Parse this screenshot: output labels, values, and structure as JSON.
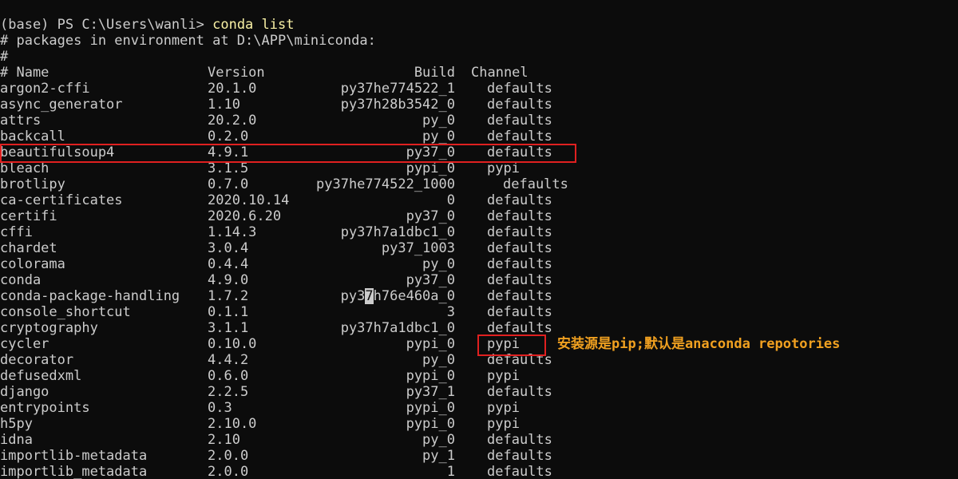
{
  "terminal": {
    "prompt": "(base) PS C:\\Users\\wanli> ",
    "command": "conda list",
    "header_line": "# packages in environment at D:\\APP\\miniconda:",
    "hash_line": "#",
    "columns": {
      "name": "# Name",
      "version": "Version",
      "build": "Build",
      "channel": "Channel"
    },
    "rows": [
      {
        "name": "argon2-cffi",
        "version": "20.1.0",
        "build": "py37he774522_1",
        "channel": "defaults"
      },
      {
        "name": "async_generator",
        "version": "1.10",
        "build": "py37h28b3542_0",
        "channel": "defaults"
      },
      {
        "name": "attrs",
        "version": "20.2.0",
        "build": "py_0",
        "channel": "defaults"
      },
      {
        "name": "backcall",
        "version": "0.2.0",
        "build": "py_0",
        "channel": "defaults"
      },
      {
        "name": "beautifulsoup4",
        "version": "4.9.1",
        "build": "py37_0",
        "channel": "defaults"
      },
      {
        "name": "bleach",
        "version": "3.1.5",
        "build": "pypi_0",
        "channel": "pypi"
      },
      {
        "name": "brotlipy",
        "version": "0.7.0",
        "build": "py37he774522_1000",
        "channel": "defaults"
      },
      {
        "name": "ca-certificates",
        "version": "2020.10.14",
        "build": "0",
        "channel": "defaults"
      },
      {
        "name": "certifi",
        "version": "2020.6.20",
        "build": "py37_0",
        "channel": "defaults"
      },
      {
        "name": "cffi",
        "version": "1.14.3",
        "build": "py37h7a1dbc1_0",
        "channel": "defaults"
      },
      {
        "name": "chardet",
        "version": "3.0.4",
        "build": "py37_1003",
        "channel": "defaults"
      },
      {
        "name": "colorama",
        "version": "0.4.4",
        "build": "py_0",
        "channel": "defaults"
      },
      {
        "name": "conda",
        "version": "4.9.0",
        "build": "py37_0",
        "channel": "defaults"
      },
      {
        "name": "conda-package-handling",
        "version": "1.7.2",
        "build_pre": "py3",
        "build_cursor": "7",
        "build_post": "h76e460a_0",
        "channel": "defaults"
      },
      {
        "name": "console_shortcut",
        "version": "0.1.1",
        "build": "3",
        "channel": "defaults"
      },
      {
        "name": "cryptography",
        "version": "3.1.1",
        "build": "py37h7a1dbc1_0",
        "channel": "defaults"
      },
      {
        "name": "cycler",
        "version": "0.10.0",
        "build": "pypi_0",
        "channel": "pypi"
      },
      {
        "name": "decorator",
        "version": "4.4.2",
        "build": "py_0",
        "channel": "defaults"
      },
      {
        "name": "defusedxml",
        "version": "0.6.0",
        "build": "pypi_0",
        "channel": "pypi"
      },
      {
        "name": "django",
        "version": "2.2.5",
        "build": "py37_1",
        "channel": "defaults"
      },
      {
        "name": "entrypoints",
        "version": "0.3",
        "build": "pypi_0",
        "channel": "pypi"
      },
      {
        "name": "h5py",
        "version": "2.10.0",
        "build": "pypi_0",
        "channel": "pypi"
      },
      {
        "name": "idna",
        "version": "2.10",
        "build": "py_0",
        "channel": "defaults"
      },
      {
        "name": "importlib-metadata",
        "version": "2.0.0",
        "build": "py_1",
        "channel": "defaults"
      },
      {
        "name": "importlib_metadata",
        "version": "2.0.0",
        "build": "1",
        "channel": "defaults"
      }
    ]
  },
  "annotation": {
    "text": "安装源是pip;默认是anaconda repotories"
  },
  "colors": {
    "background": "#0c0c0c",
    "text": "#cccccc",
    "command": "#f9f1a5",
    "highlight_box": "#e02020",
    "annotation": "#f0a020"
  }
}
